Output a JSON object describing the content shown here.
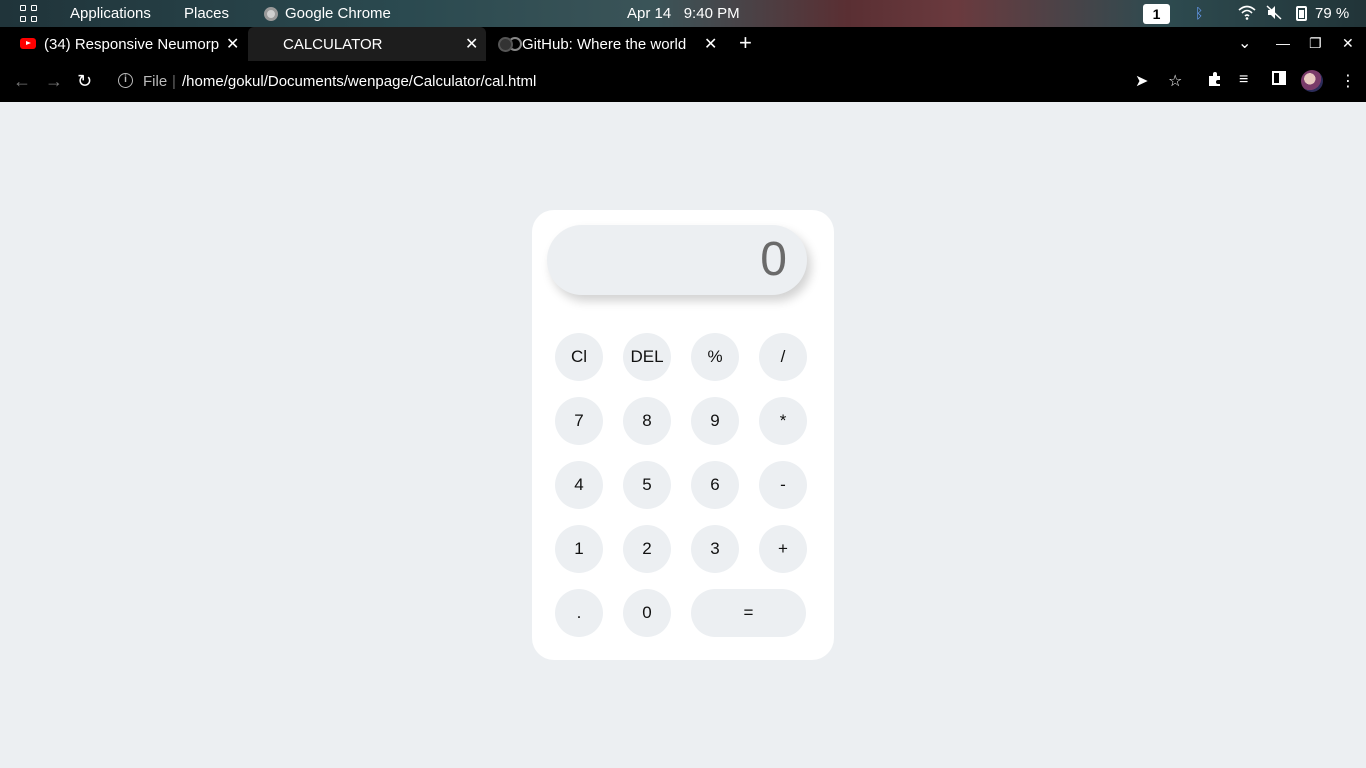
{
  "topbar": {
    "applications": "Applications",
    "places": "Places",
    "app_name": "Google Chrome",
    "date": "Apr 14",
    "time": "9:40 PM",
    "workspace": "1",
    "battery": "79 %"
  },
  "tabs": [
    {
      "title": "(34) Responsive Neumorp",
      "icon": "youtube-icon"
    },
    {
      "title": "CALCULATOR",
      "icon": "globe-icon",
      "active": true
    },
    {
      "title": "GitHub: Where the world",
      "icon": "github-icon"
    }
  ],
  "address": {
    "scheme": "File",
    "url": "/home/gokul/Documents/wenpage/Calculator/cal.html"
  },
  "calculator": {
    "display": "0",
    "rows": [
      [
        "Cl",
        "DEL",
        "%",
        "/"
      ],
      [
        "7",
        "8",
        "9",
        "*"
      ],
      [
        "4",
        "5",
        "6",
        "-"
      ],
      [
        "1",
        "2",
        "3",
        "+"
      ],
      [
        ".",
        "0",
        "="
      ]
    ]
  },
  "colors": {
    "page_bg": "#eceff2",
    "card_bg": "#ffffff",
    "key_bg": "#eceff2",
    "chrome_bg": "#000000"
  }
}
